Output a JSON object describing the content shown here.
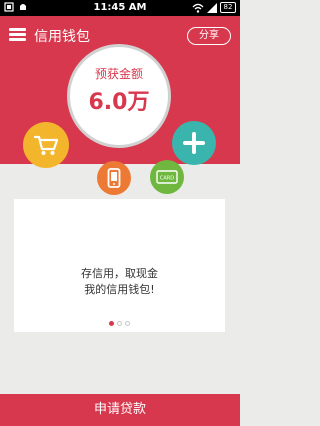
{
  "status_bar": {
    "time": "11:45 AM",
    "battery": "82",
    "icons": [
      "notification-icon",
      "android-icon",
      "wifi-icon",
      "signal-icon",
      "battery-icon"
    ]
  },
  "header": {
    "title": "信用钱包",
    "share_label": "分享"
  },
  "summary": {
    "label": "预获金额",
    "value": "6.0万"
  },
  "actions": [
    {
      "icon": "cart-icon",
      "color": "#f3b52c"
    },
    {
      "icon": "phone-icon",
      "color": "#ec7a35"
    },
    {
      "icon": "card-icon",
      "color": "#6fb73e",
      "text": "CARD"
    },
    {
      "icon": "plus-icon",
      "color": "#39b5ad"
    }
  ],
  "content": {
    "line1": "存信用，取现金",
    "line2": "我的信用钱包!"
  },
  "pagination": {
    "current": 1,
    "total": 3
  },
  "footer": {
    "button_label": "申请贷款"
  },
  "colors": {
    "brand": "#d8384d",
    "background": "#ebebea"
  }
}
